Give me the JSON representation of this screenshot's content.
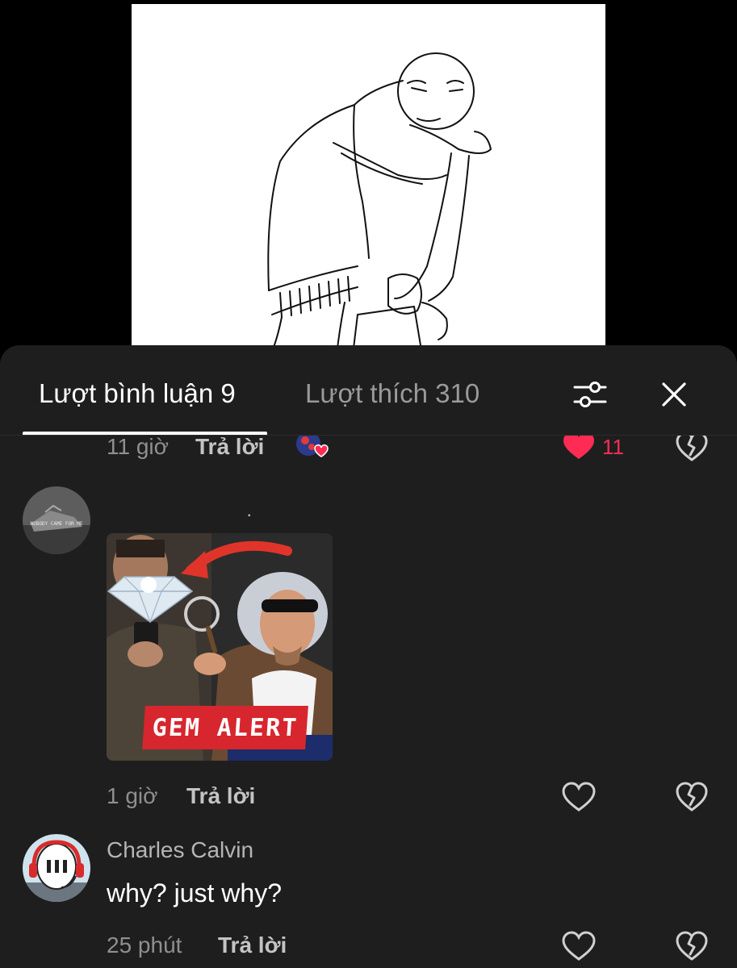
{
  "tabs": {
    "comments_label": "Lượt bình luận 9",
    "likes_label": "Lượt thích 310"
  },
  "comments": [
    {
      "time": "11 giờ",
      "reply_label": "Trả lời",
      "like_count": "11",
      "liked": true,
      "has_reaction_badge": true
    },
    {
      "avatar_caption": "NOBODY CAME FOR ME",
      "text": "·",
      "sticker_caption": "GEM ALERT",
      "time": "1 giờ",
      "reply_label": "Trả lời"
    },
    {
      "username": "Charles Calvin",
      "text": "why? just why?",
      "time": "25 phút",
      "reply_label": "Trả lời"
    }
  ],
  "icons": {
    "filter": "sliders-icon",
    "close": "close-icon",
    "like": "heart-icon",
    "dislike": "broken-heart-icon"
  },
  "colors": {
    "sheet_background": "#1e1e1e",
    "accent_like": "#fe2c55",
    "banner_red": "#d7262e"
  }
}
